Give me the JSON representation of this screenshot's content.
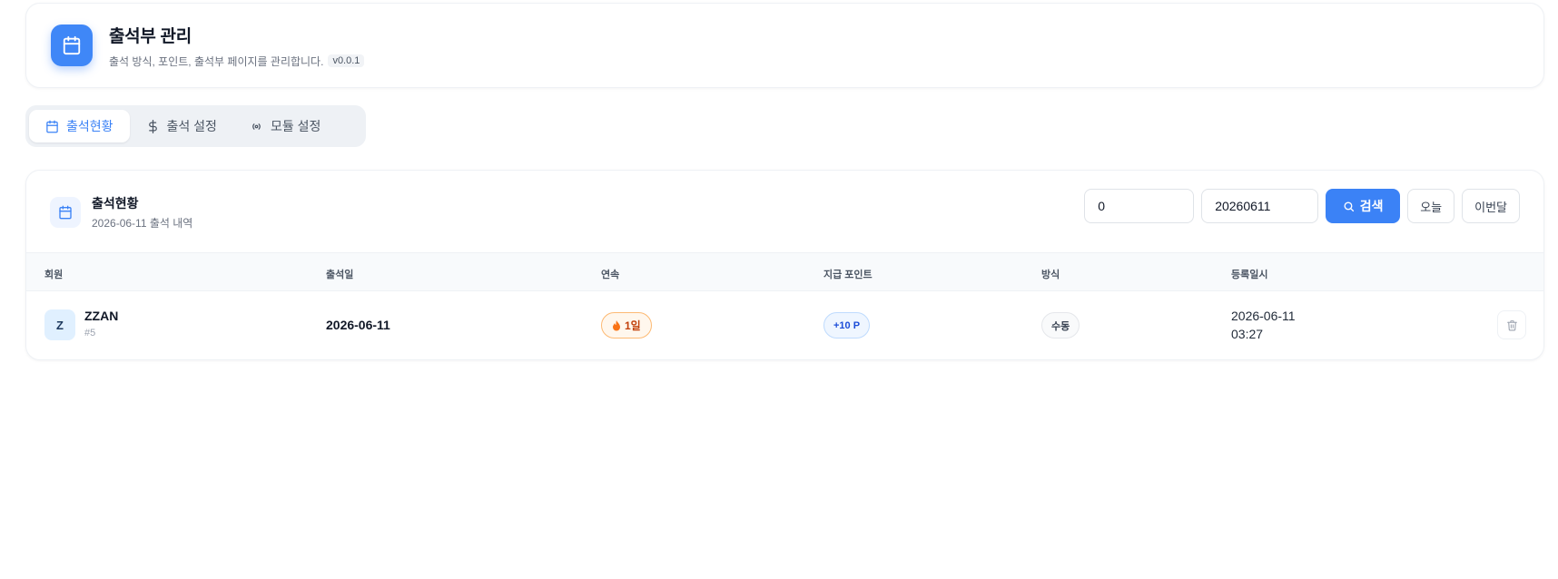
{
  "header": {
    "title": "출석부 관리",
    "subtitle": "출석 방식, 포인트, 출석부 페이지를 관리합니다.",
    "version": "v0.0.1",
    "icon": "calendar-icon"
  },
  "tabs": [
    {
      "label": "출석현황",
      "icon": "calendar-icon",
      "active": true
    },
    {
      "label": "출석 설정",
      "icon": "dollar-icon",
      "active": false
    },
    {
      "label": "모듈 설정",
      "icon": "broadcast-icon",
      "active": false
    }
  ],
  "panel": {
    "title": "출석현황",
    "subtitle": "2026-06-11 출석 내역",
    "filter_value_1": "0",
    "filter_value_2": "20260611",
    "search_label": "검색",
    "today_label": "오늘",
    "this_month_label": "이번달"
  },
  "table": {
    "columns": [
      "회원",
      "출석일",
      "연속",
      "지급 포인트",
      "방식",
      "등록일시"
    ],
    "rows": [
      {
        "avatar_letter": "Z",
        "member_name": "ZZAN",
        "member_id": "#5",
        "date": "2026-06-11",
        "streak": "1일",
        "points": "+10 P",
        "method": "수동",
        "reg_date": "2026-06-11",
        "reg_time": "03:27"
      }
    ]
  },
  "colors": {
    "accent": "#3b82f6",
    "streak": "#c2410c",
    "point": "#1d4ed8"
  }
}
